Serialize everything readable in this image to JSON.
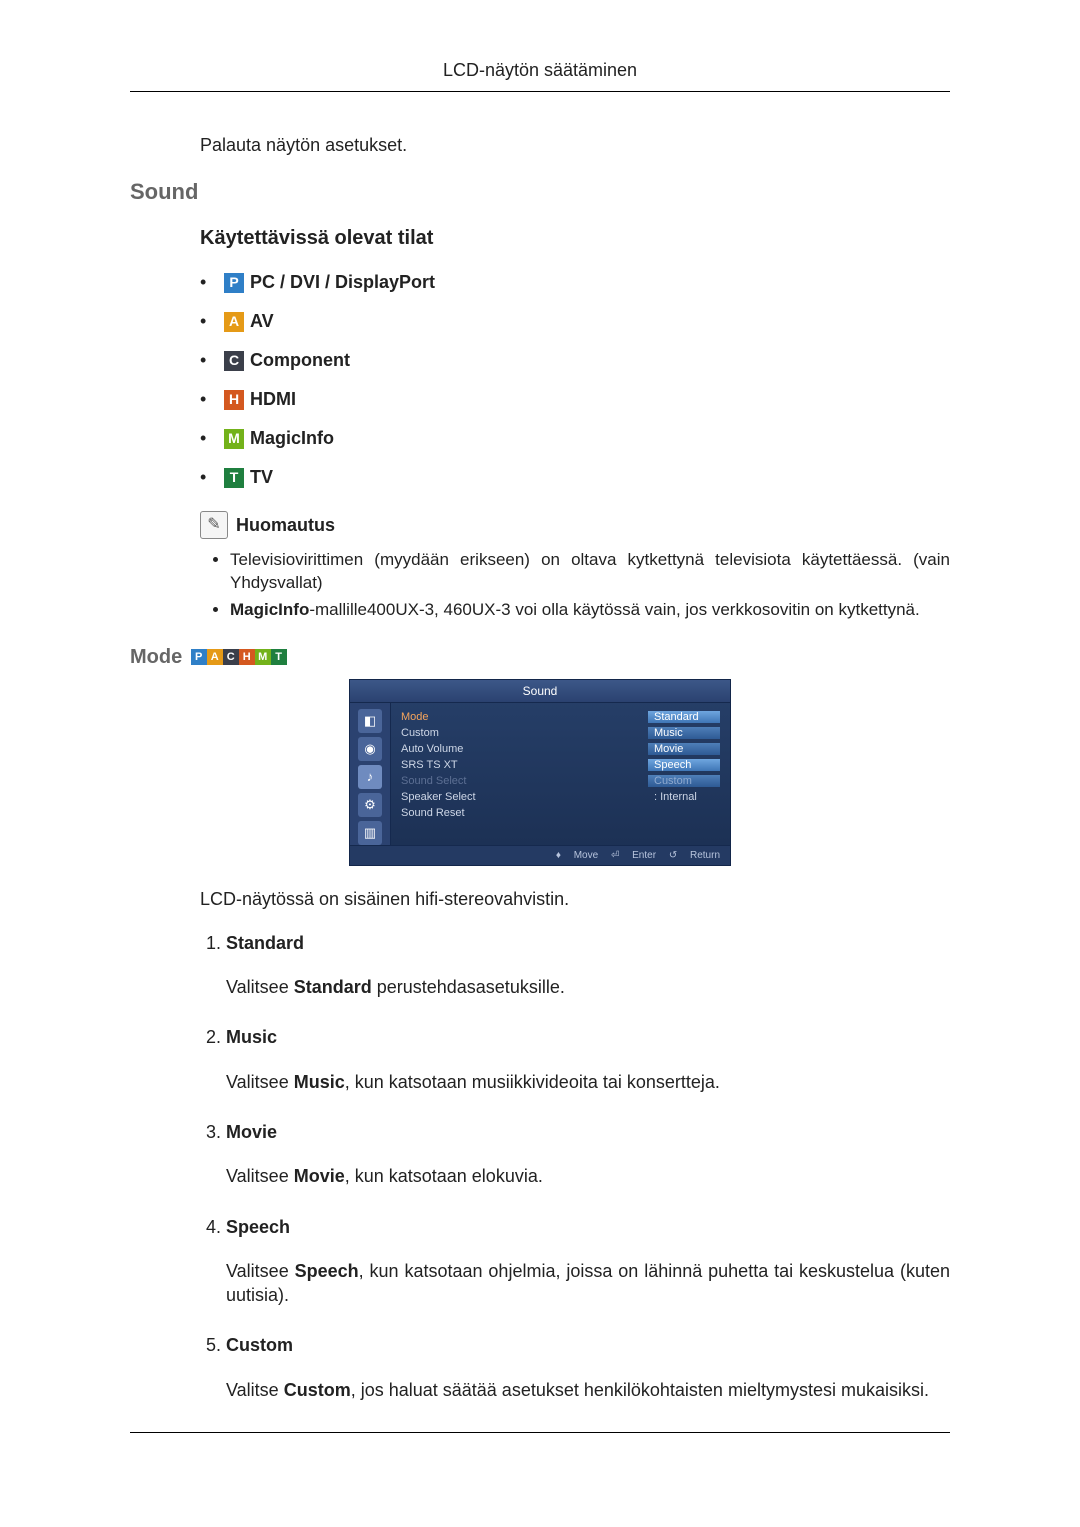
{
  "header": {
    "title": "LCD-näytön säätäminen"
  },
  "intro_text": "Palauta näytön asetukset.",
  "section_sound": "Sound",
  "subsection_modes": "Käytettävissä olevat tilat",
  "icons": {
    "P": {
      "letter": "P",
      "bg": "#2f7fc7",
      "label": "PC / DVI / DisplayPort"
    },
    "A": {
      "letter": "A",
      "bg": "#e59a17",
      "label": "AV"
    },
    "C": {
      "letter": "C",
      "bg": "#3b3f4a",
      "label": "Component"
    },
    "H": {
      "letter": "H",
      "bg": "#d4581f",
      "label": "HDMI"
    },
    "M": {
      "letter": "M",
      "bg": "#73b21a",
      "label": "MagicInfo"
    },
    "T": {
      "letter": "T",
      "bg": "#1f7f3f",
      "label": "TV"
    }
  },
  "note": {
    "label": "Huomautus",
    "items": [
      {
        "text": "Televisiovirittimen (myydään erikseen) on oltava kytkettynä televisiota käytettäessä. (vain Yhdysvallat)"
      },
      {
        "pre": "MagicInfo",
        "post": "-mallille400UX-3, 460UX-3 voi olla käytössä vain, jos verkkosovitin on kytkettynä."
      }
    ]
  },
  "mode_heading": "Mode",
  "osd": {
    "title": "Sound",
    "rows": [
      {
        "label": "Mode",
        "value": "Standard",
        "sel": true,
        "box": true,
        "cur": true
      },
      {
        "label": "Custom",
        "value": "Music",
        "box": true
      },
      {
        "label": "Auto Volume",
        "value": "Movie",
        "box": true
      },
      {
        "label": "SRS TS XT",
        "value": "Speech",
        "box": true,
        "cur": true
      },
      {
        "label": "Sound Select",
        "value": "Custom",
        "dim": true,
        "box": true,
        "valdim": true
      },
      {
        "label": "Speaker Select",
        "value": ": Internal",
        "plain": true
      },
      {
        "label": "Sound Reset",
        "value": "",
        "plain": true
      }
    ],
    "footer": {
      "move": "Move",
      "enter": "Enter",
      "ret": "Return"
    }
  },
  "after_osd": "LCD-näytössä on sisäinen hifi-stereovahvistin.",
  "defs": [
    {
      "term": "Standard",
      "pre": "Valitsee ",
      "bold": "Standard",
      "post": " perustehdasasetuksille."
    },
    {
      "term": "Music",
      "pre": "Valitsee ",
      "bold": "Music",
      "post": ", kun katsotaan musiikkivideoita tai konsertteja."
    },
    {
      "term": "Movie",
      "pre": "Valitsee ",
      "bold": "Movie",
      "post": ", kun katsotaan elokuvia."
    },
    {
      "term": "Speech",
      "pre": "Valitsee ",
      "bold": "Speech",
      "post": ", kun katsotaan ohjelmia, joissa on lähinnä puhetta tai keskustelua (kuten uutisia)."
    },
    {
      "term": "Custom",
      "pre": "Valitse ",
      "bold": "Custom",
      "post": ", jos haluat säätää asetukset henkilökohtaisten mieltymystesi mukaisiksi."
    }
  ]
}
